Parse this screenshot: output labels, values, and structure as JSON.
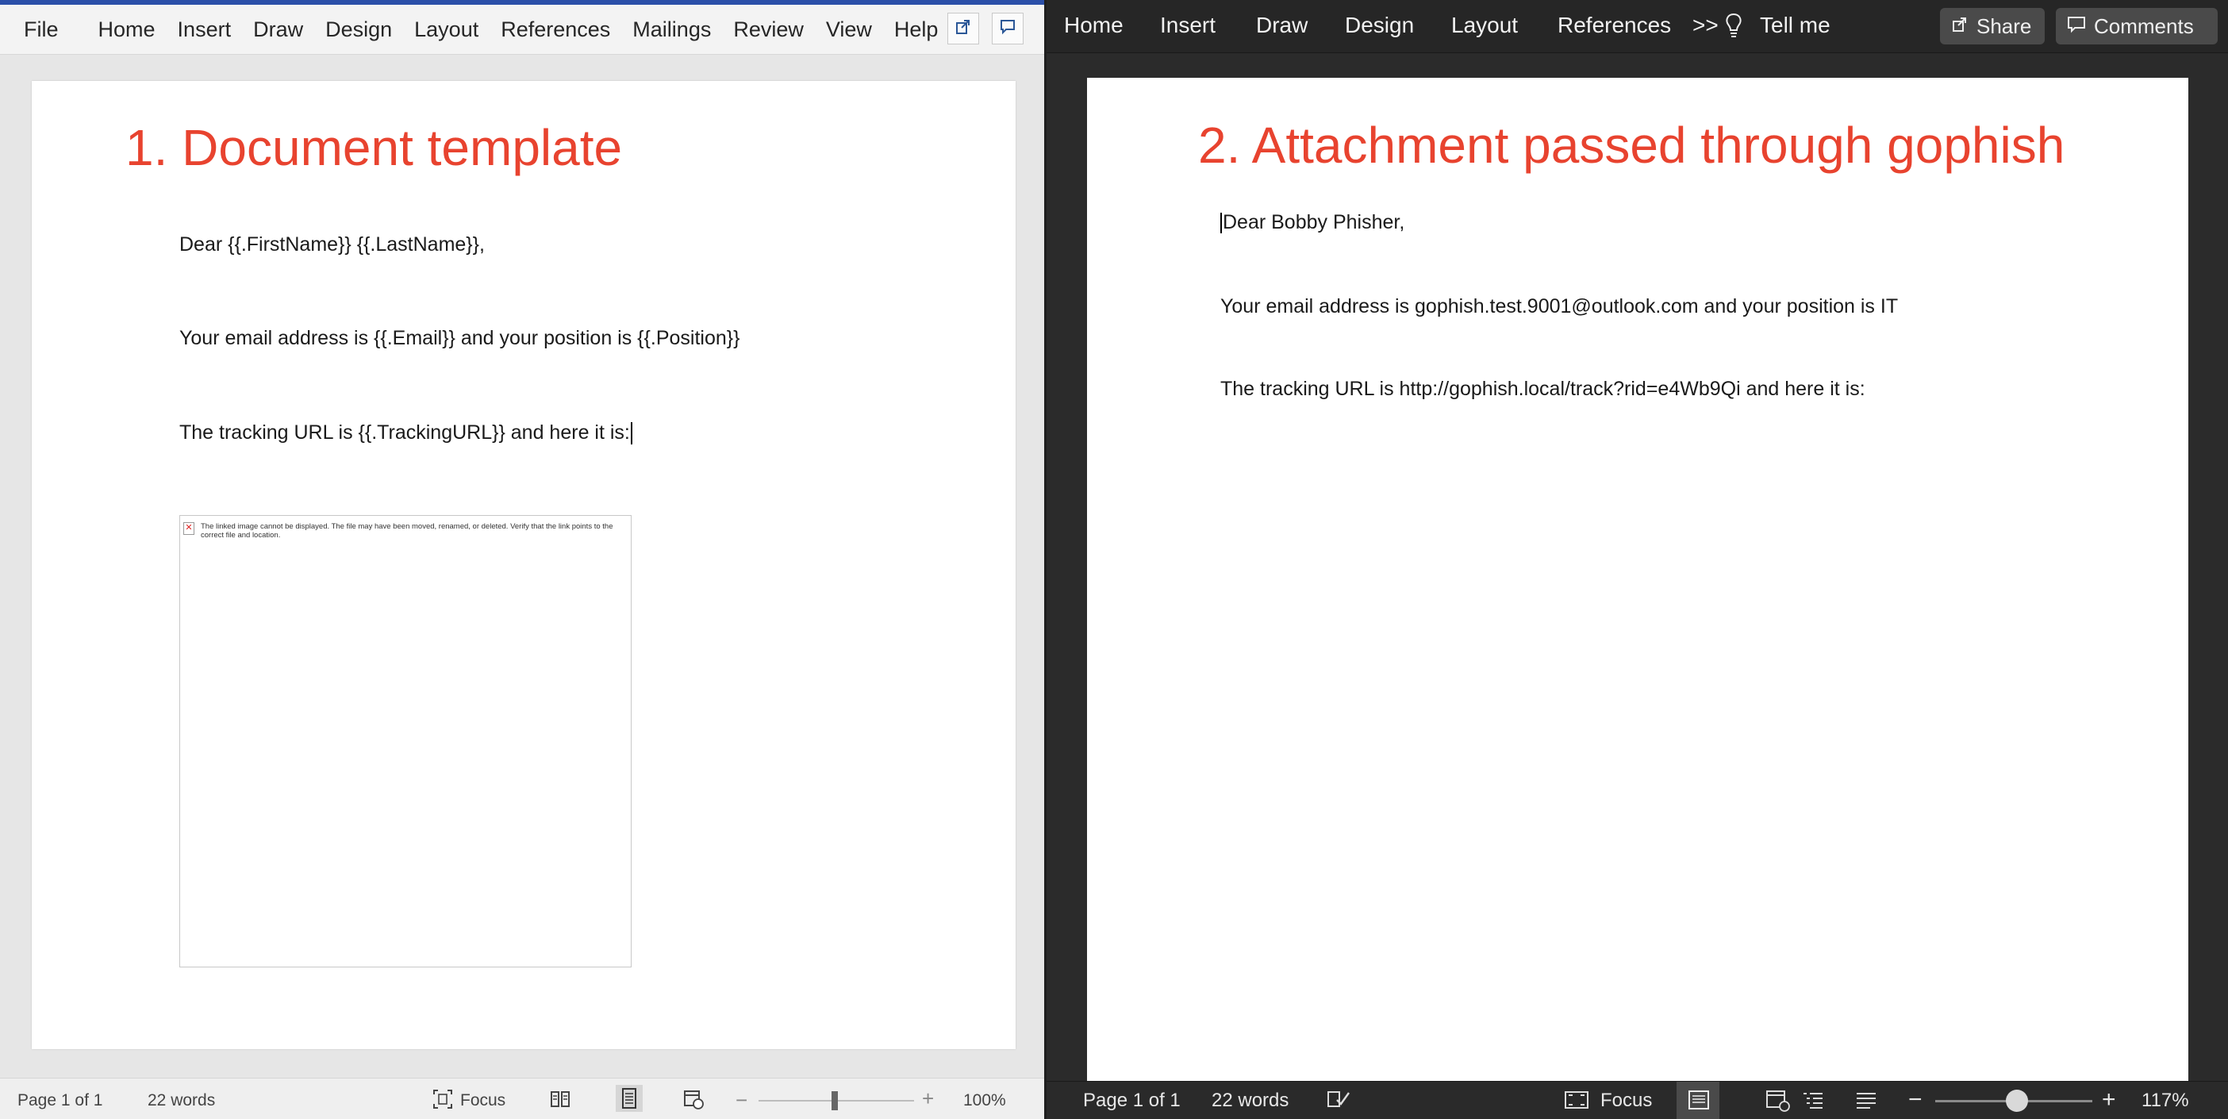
{
  "left_window": {
    "ribbon_tabs": [
      "File",
      "Home",
      "Insert",
      "Draw",
      "Design",
      "Layout",
      "References",
      "Mailings",
      "Review",
      "View",
      "Help"
    ],
    "icons": [
      "share-icon",
      "comment-icon"
    ],
    "document": {
      "heading": "1. Document template",
      "lines": [
        "Dear {{.FirstName}} {{.LastName}},",
        "Your email address is {{.Email}} and your position is {{.Position}}",
        "The tracking URL is {{.TrackingURL}} and here it is:"
      ],
      "broken_image_message": "The linked image cannot be displayed.  The file may have been moved, renamed, or deleted. Verify that the link points to the correct file and location."
    },
    "status_bar": {
      "page": "Page 1 of 1",
      "words": "22 words",
      "focus": "Focus",
      "zoom_minus": "−",
      "zoom_plus": "+",
      "zoom": "100%",
      "zoom_level_percent": 100
    }
  },
  "right_window": {
    "ribbon_tabs": [
      "Home",
      "Insert",
      "Draw",
      "Design",
      "Layout",
      "References"
    ],
    "overflow_label": ">>",
    "tell_me": "Tell me",
    "share_label": "Share",
    "comments_label": "Comments",
    "document": {
      "heading": "2. Attachment passed through gophish",
      "lines": [
        "Dear Bobby Phisher,",
        "Your email address is gophish.test.9001@outlook.com and your position is IT",
        "The tracking URL is http://gophish.local/track?rid=e4Wb9Qi and here it is:"
      ]
    },
    "status_bar": {
      "page": "Page 1 of 1",
      "words": "22 words",
      "focus": "Focus",
      "zoom_minus": "−",
      "zoom_plus": "+",
      "zoom": "117%",
      "zoom_level_percent": 117
    }
  }
}
